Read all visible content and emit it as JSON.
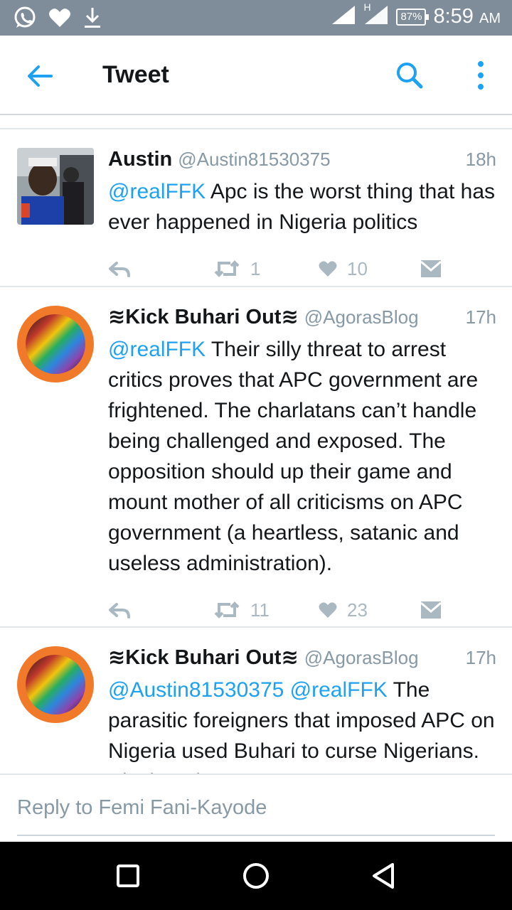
{
  "status_bar": {
    "time": "8:59",
    "ampm": "AM",
    "battery": "87%",
    "network": "H"
  },
  "app_bar": {
    "title": "Tweet"
  },
  "tweets": [
    {
      "name": "Austin",
      "handle": "@Austin81530375",
      "time": "18h",
      "mentions": "@realFFK",
      "text": " Apc is the worst thing that has ever happened in Nigeria politics",
      "retweets": "1",
      "likes": "10"
    },
    {
      "name": "≋Kick Buhari Out≋",
      "handle": "@AgorasBlog",
      "time": "17h",
      "mentions": "@realFFK",
      "text": " Their silly threat to arrest critics proves that APC government are frightened. The charlatans can’t handle being challenged and exposed. The opposition should up their game and mount mother of all criticisms on APC government (a heartless, satanic and useless administration).",
      "retweets": "11",
      "likes": "23"
    },
    {
      "name": "≋Kick Buhari Out≋",
      "handle": "@AgorasBlog",
      "time": "17h",
      "mentions": "@Austin81530375 @realFFK",
      "text": " The parasitic foreigners that imposed APC on Nigeria used Buhari to curse Nigerians. Black natives",
      "retweets": "",
      "likes": ""
    }
  ],
  "reply": {
    "placeholder": "Reply to Femi Fani-Kayode"
  },
  "colors": {
    "accent": "#1da1f2",
    "status_bar": "#7f8d9a",
    "muted": "#8899a6"
  }
}
